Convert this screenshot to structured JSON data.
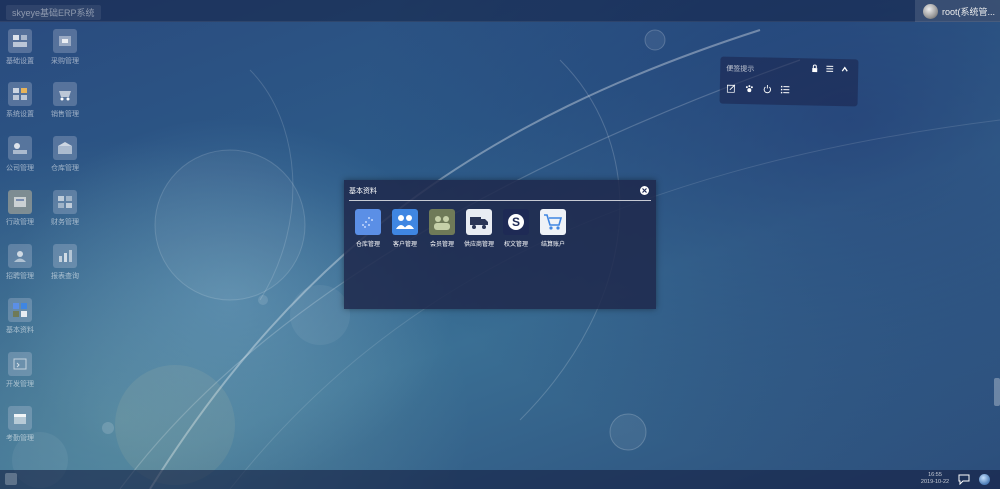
{
  "window": {
    "title": "skyeye基础ERP系统"
  },
  "user": {
    "name": "root(系统管..."
  },
  "desktop_icons": [
    {
      "label": "基础设置"
    },
    {
      "label": "系统设置"
    },
    {
      "label": "公司管理"
    },
    {
      "label": "行政管理"
    },
    {
      "label": "招聘管理"
    },
    {
      "label": "基本资料"
    },
    {
      "label": "开发管理"
    },
    {
      "label": "考勤管理"
    },
    {
      "label": "采购管理"
    },
    {
      "label": "销售管理"
    },
    {
      "label": "仓库管理"
    },
    {
      "label": "财务管理"
    },
    {
      "label": "报表查询"
    }
  ],
  "widget": {
    "title": "便签提示"
  },
  "modal": {
    "title": "基本资料",
    "apps": [
      {
        "label": "仓库管理",
        "color": "#5b8fe6",
        "icon": "warehouse-icon"
      },
      {
        "label": "客户管理",
        "color": "#3f86e2",
        "icon": "customers-icon"
      },
      {
        "label": "会员管理",
        "color": "#6f7a58",
        "icon": "members-icon"
      },
      {
        "label": "供应商管理",
        "color": "#e8ecf2",
        "icon": "truck-icon"
      },
      {
        "label": "权文管理",
        "color": "#1e2a55",
        "icon": "skype-icon"
      },
      {
        "label": "结算账户",
        "color": "#eef2f7",
        "icon": "cart-icon"
      }
    ]
  },
  "taskbar": {
    "time": "16:55",
    "date": "2019-10-22"
  }
}
